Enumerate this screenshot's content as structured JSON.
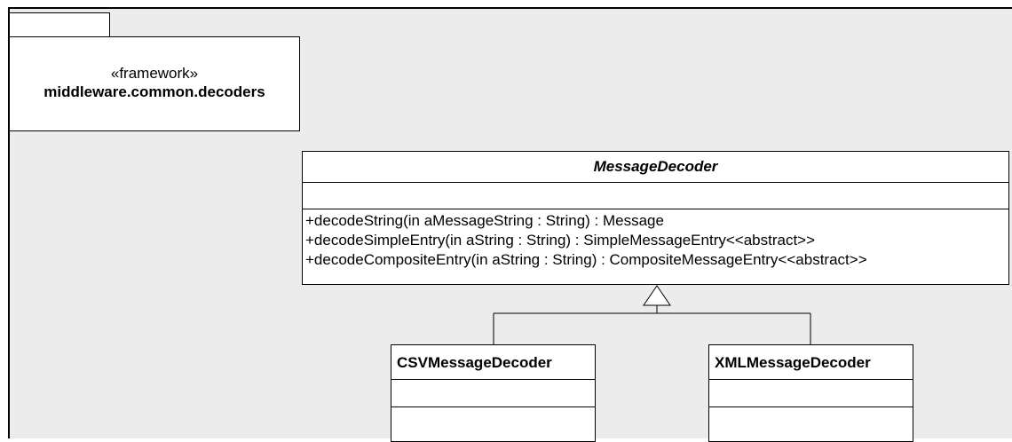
{
  "package": {
    "stereotype": "«framework»",
    "name": "middleware.common.decoders"
  },
  "abstract_class": {
    "name": "MessageDecoder",
    "attributes": [],
    "operations": [
      "+decodeString(in aMessageString : String) : Message",
      "+decodeSimpleEntry(in aString : String) : SimpleMessageEntry<<abstract>>",
      "+decodeCompositeEntry(in aString : String) : CompositeMessageEntry<<abstract>>"
    ]
  },
  "subclasses": [
    {
      "name": "CSVMessageDecoder"
    },
    {
      "name": "XMLMessageDecoder"
    }
  ],
  "relationship": "generalization"
}
